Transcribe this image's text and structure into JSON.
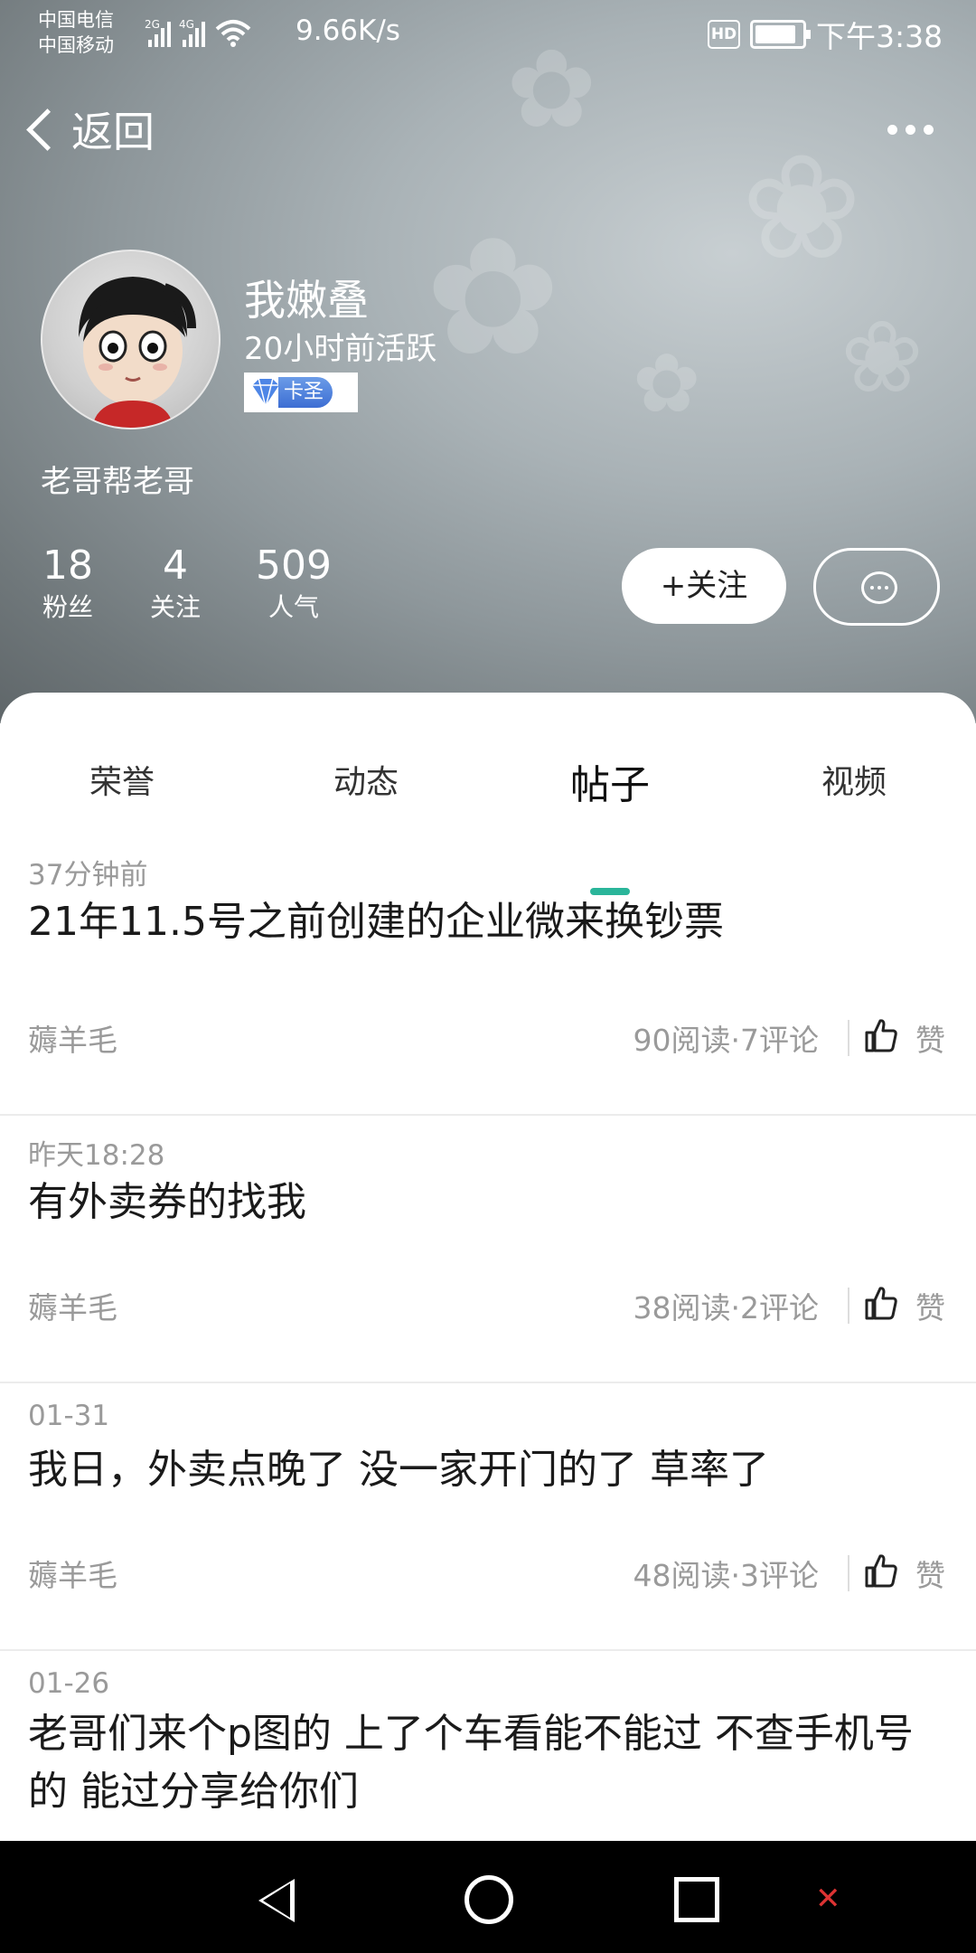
{
  "status_bar": {
    "carrier1": "中国电信",
    "carrier2": "中国移动",
    "net1": "2G",
    "net2": "4G",
    "speed": "9.66K/s",
    "hd": "HD",
    "time": "下午3:38"
  },
  "nav": {
    "back_label": "返回"
  },
  "profile": {
    "name": "我嫩叠",
    "active": "20小时前活跃",
    "level": "卡圣",
    "signature": "老哥帮老哥",
    "stats": [
      {
        "value": "18",
        "label": "粉丝"
      },
      {
        "value": "4",
        "label": "关注"
      },
      {
        "value": "509",
        "label": "人气"
      }
    ],
    "follow_label": "+关注"
  },
  "tabs": [
    {
      "label": "荣誉"
    },
    {
      "label": "动态"
    },
    {
      "label": "帖子"
    },
    {
      "label": "视频"
    }
  ],
  "active_tab": "帖子",
  "posts": [
    {
      "time": "37分钟前",
      "title": "21年11.5号之前创建的企业微来换钞票",
      "category": "薅羊毛",
      "stats": "90阅读·7评论",
      "like": "赞"
    },
    {
      "time": "昨天18:28",
      "title": "有外卖券的找我",
      "category": "薅羊毛",
      "stats": "38阅读·2评论",
      "like": "赞"
    },
    {
      "time": "01-31",
      "title": "我日，外卖点晚了 没一家开门的了 草率了",
      "category": "薅羊毛",
      "stats": "48阅读·3评论",
      "like": "赞"
    },
    {
      "time": "01-26",
      "title": "老哥们来个p图的  上了个车看能不能过 不查手机号的 能过分享给你们",
      "category": "",
      "stats": "",
      "like": ""
    }
  ],
  "colors": {
    "accent": "#2ab59a",
    "level_badge": "#3d6ed3"
  },
  "icons": [
    "back-chevron-icon",
    "more-dots-icon",
    "message-bubble-icon",
    "thumbs-up-icon",
    "nav-back-icon",
    "nav-home-icon",
    "nav-recent-icon"
  ]
}
